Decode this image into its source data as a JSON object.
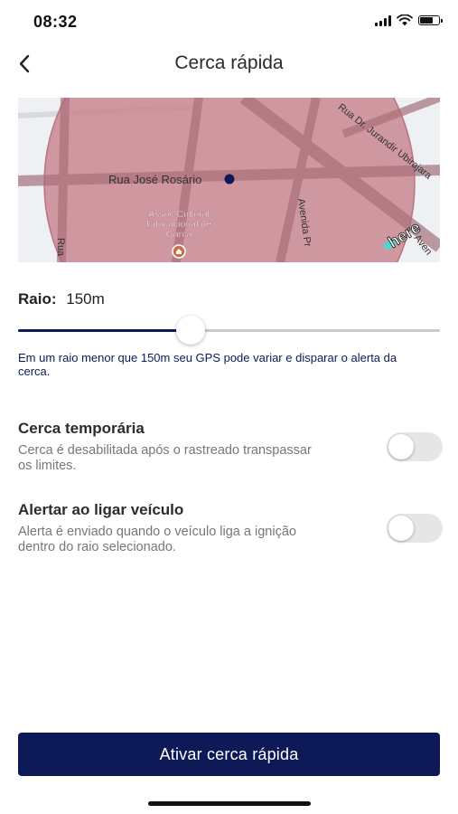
{
  "status_bar": {
    "time": "08:32",
    "battery_level": 0.7
  },
  "nav": {
    "title": "Cerca rápida",
    "back_icon": "chevron-left-icon"
  },
  "map": {
    "streets": {
      "main": "Rua José Rosário",
      "right_top": "Rua Dr. Jurandir Ubirajara",
      "avenida": "Avenida Pr",
      "left_edge": "Rua",
      "corner": "Aven"
    },
    "poi": [
      "Assoc Cultural",
      "Educacional de",
      "Garça"
    ],
    "logo": "here",
    "fence_color": "#c9878f",
    "marker_color": "#0d1a57"
  },
  "radius": {
    "label": "Raio:",
    "value": "150m",
    "slider_fraction": 0.41
  },
  "hint": "Em um raio menor que 150m seu GPS pode variar e disparar o alerta da cerca.",
  "options": [
    {
      "title": "Cerca temporária",
      "description": "Cerca é desabilitada após o rastreado transpassar os limites.",
      "enabled": false
    },
    {
      "title": "Alertar ao ligar veículo",
      "description": "Alerta é enviado quando o veículo liga a ignição dentro do raio selecionado.",
      "enabled": false
    }
  ],
  "primary_button": "Ativar cerca rápida",
  "colors": {
    "accent": "#0d1a57",
    "toggle_off": "#e6e6e6"
  }
}
